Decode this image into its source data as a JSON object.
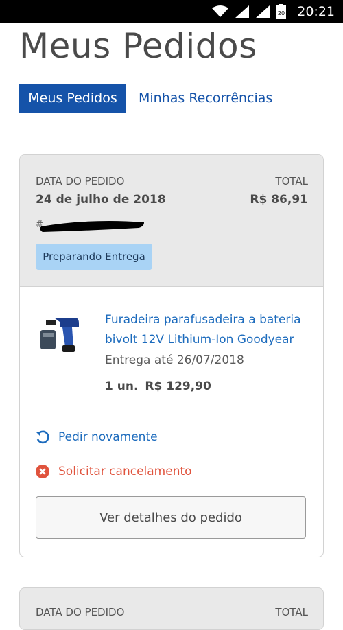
{
  "status_bar": {
    "time": "20:21",
    "sim_label": "20"
  },
  "page": {
    "title": "Meus Pedidos"
  },
  "tabs": [
    {
      "label": "Meus Pedidos",
      "active": true
    },
    {
      "label": "Minhas Recorrências",
      "active": false
    }
  ],
  "order": {
    "date_label": "DATA DO PEDIDO",
    "date_value": "24 de julho de 2018",
    "total_label": "TOTAL",
    "total_value": "R$ 86,91",
    "number_prefix": "#",
    "status": "Preparando Entrega",
    "item": {
      "name": "Furadeira parafusadeira a bateria bivolt 12V Lithium-Ion Goodyear",
      "delivery": "Entrega até 26/07/2018",
      "quantity": "1 un.",
      "price": "R$ 129,90"
    },
    "actions": {
      "reorder": "Pedir novamente",
      "cancel": "Solicitar cancelamento",
      "details": "Ver detalhes do pedido"
    }
  },
  "next_order": {
    "date_label": "DATA DO PEDIDO",
    "total_label": "TOTAL"
  },
  "colors": {
    "primary": "#1553a9",
    "link": "#1c6bbd",
    "danger": "#e0533d",
    "status_badge": "#a9d3f5",
    "card_header": "#e9e9e9"
  }
}
